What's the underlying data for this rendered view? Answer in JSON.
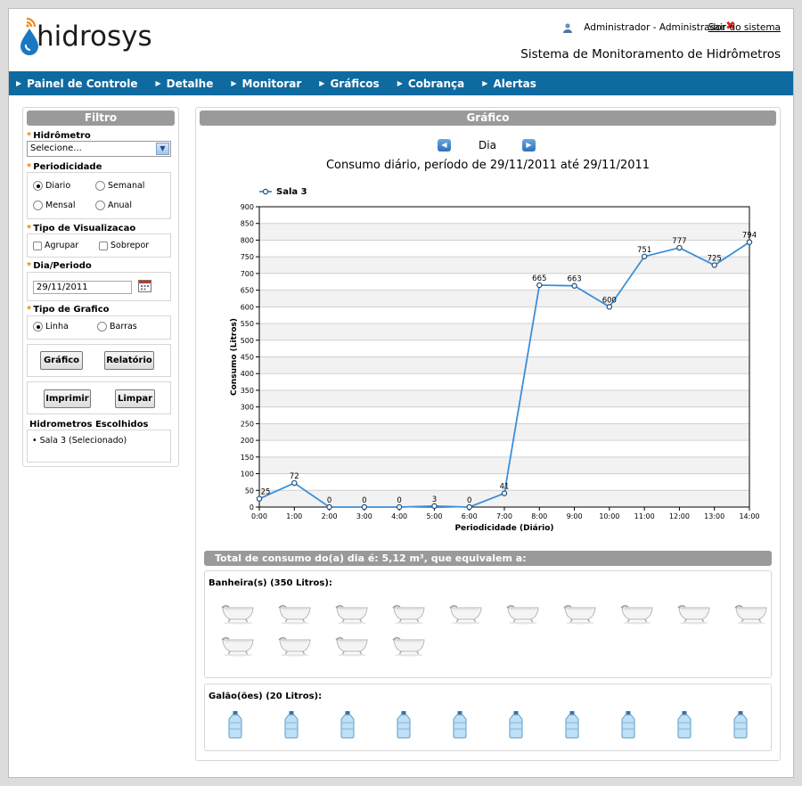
{
  "header": {
    "logo": "hidrosys",
    "user": "Administrador - Administrador",
    "logout": "Sair do sistema",
    "system_title": "Sistema de Monitoramento de Hidrômetros"
  },
  "nav": [
    "Painel de Controle",
    "Detalhe",
    "Monitorar",
    "Gráficos",
    "Cobrança",
    "Alertas"
  ],
  "filter": {
    "title": "Filtro",
    "hidrometro_label": "Hidrômetro",
    "hidrometro_value": "Selecione...",
    "periodicidade_label": "Periodicidade",
    "periodicidade_options": [
      "Diario",
      "Semanal",
      "Mensal",
      "Anual"
    ],
    "periodicidade_selected": "Diario",
    "visualizacao_label": "Tipo de Visualizacao",
    "visualizacao_options": [
      "Agrupar",
      "Sobrepor"
    ],
    "dia_label": "Dia/Periodo",
    "dia_value": "29/11/2011",
    "grafico_label": "Tipo de Grafico",
    "grafico_options": [
      "Linha",
      "Barras"
    ],
    "grafico_selected": "Linha",
    "buttons": [
      "Gráfico",
      "Relatório",
      "Imprimir",
      "Limpar"
    ],
    "escolhidos_label": "Hidrometros Escolhidos",
    "escolhidos": [
      "Sala 3 (Selecionado)"
    ]
  },
  "graph_panel": {
    "title": "Gráfico",
    "period": "Dia",
    "subtitle": "Consumo diário, período de 29/11/2011 até 29/11/2011"
  },
  "chart_data": {
    "type": "line",
    "x": [
      "0:00",
      "1:00",
      "2:00",
      "3:00",
      "4:00",
      "5:00",
      "6:00",
      "7:00",
      "8:00",
      "9:00",
      "10:00",
      "11:00",
      "12:00",
      "13:00",
      "14:00"
    ],
    "series": [
      {
        "name": "Sala 3",
        "values": [
          25,
          72,
          0,
          0,
          0,
          3,
          0,
          41,
          665,
          663,
          600,
          751,
          777,
          725,
          794
        ]
      }
    ],
    "xlabel": "Periodicidade (Diário)",
    "ylabel": "Consumo (Litros)",
    "ylim": [
      0,
      900
    ],
    "yticks": [
      0,
      50,
      100,
      150,
      200,
      250,
      300,
      350,
      400,
      450,
      500,
      550,
      600,
      650,
      700,
      750,
      800,
      850,
      900
    ],
    "legend": "top-left",
    "grid": true,
    "line_color": "#3b8fd9"
  },
  "total": {
    "text": "Total de consumo do(a) dia é: 5,12 m³, que equivalem a:",
    "banheira_label": "Banheira(s) (350 Litros):",
    "banheira_count": 14,
    "galao_label": "Galão(ões) (20 Litros):",
    "galao_count": 10
  }
}
